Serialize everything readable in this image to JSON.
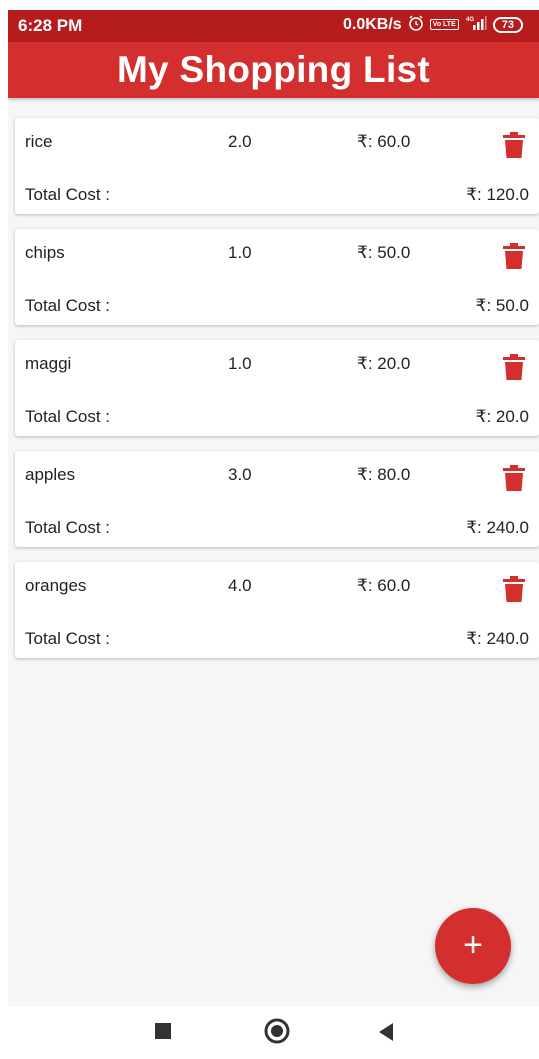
{
  "status_bar": {
    "time": "6:28 PM",
    "network_speed": "0.0KB/s",
    "volte_label": "Vo LTE",
    "network_type": "4G",
    "battery": "73"
  },
  "app_bar": {
    "title": "My Shopping List"
  },
  "items": [
    {
      "name": "rice",
      "quantity": "2.0",
      "price": "₹: 60.0",
      "total_label": "Total Cost :",
      "total": "₹: 120.0"
    },
    {
      "name": "chips",
      "quantity": "1.0",
      "price": "₹: 50.0",
      "total_label": "Total Cost :",
      "total": "₹: 50.0"
    },
    {
      "name": "maggi",
      "quantity": "1.0",
      "price": "₹: 20.0",
      "total_label": "Total Cost :",
      "total": "₹: 20.0"
    },
    {
      "name": "apples",
      "quantity": "3.0",
      "price": "₹: 80.0",
      "total_label": "Total Cost :",
      "total": "₹: 240.0"
    },
    {
      "name": "oranges",
      "quantity": "4.0",
      "price": "₹: 60.0",
      "total_label": "Total Cost :",
      "total": "₹: 240.0"
    }
  ],
  "fab": {
    "icon": "plus-icon",
    "symbol": "+"
  },
  "nav_bar": {
    "icons": [
      "recents-square-icon",
      "home-circle-icon",
      "back-triangle-icon"
    ]
  },
  "colors": {
    "status_bar": "#b71c1c",
    "primary": "#d32f2f",
    "delete_icon": "#d32f2f",
    "background": "#f6f6f6"
  }
}
